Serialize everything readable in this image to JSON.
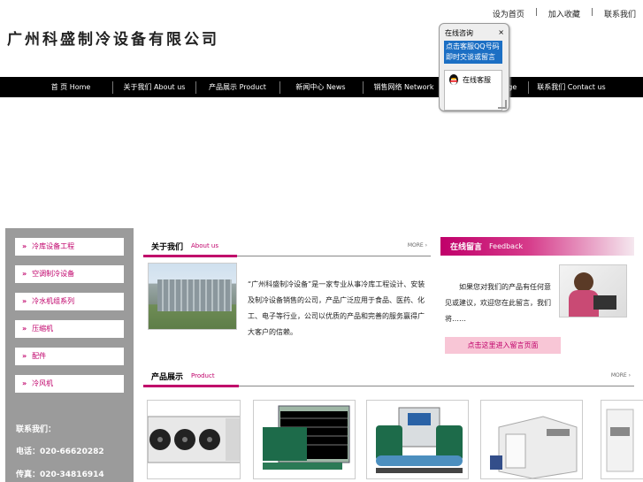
{
  "header": {
    "logo_text": "广州科盛制冷设备有限公司",
    "top_links": [
      "设为首页",
      "加入收藏",
      "联系我们"
    ],
    "top_sep": "|"
  },
  "nav": {
    "items": [
      {
        "label": "首  页 Home"
      },
      {
        "label": "关于我们 About us"
      },
      {
        "label": "产品展示 Product"
      },
      {
        "label": "新闻中心 News"
      },
      {
        "label": "销售网络 Network"
      },
      {
        "label": "在线留言 Message"
      },
      {
        "label": "联系我们 Contact us"
      }
    ]
  },
  "qq_float": {
    "title": "在线咨询",
    "close": "×",
    "message": "点击客服QQ号码即时交谈或留言",
    "contact_label": "在线客服"
  },
  "sidebar": {
    "items": [
      {
        "label": "冷库设备工程"
      },
      {
        "label": "空调制冷设备"
      },
      {
        "label": "冷水机组系列"
      },
      {
        "label": "压缩机"
      },
      {
        "label": "配件"
      },
      {
        "label": "冷风机"
      }
    ],
    "contact_title": "联系我们：",
    "phone1": "电话：020-66620282",
    "phone2": "传真：020-34816914"
  },
  "about": {
    "title_cn": "关于我们",
    "title_en": "About us",
    "more": "MORE ›",
    "text": "“广州科盛制冷设备”是一家专业从事冷库工程设计、安装及制冷设备销售的公司，产品广泛应用于食品、医药、化工、电子等行业，公司以优质的产品和完善的服务赢得广大客户的信赖。"
  },
  "feedback": {
    "title_cn": "在线留言",
    "title_en": "Feedback",
    "text": "如果您对我们的产品有任何意见或建议，欢迎您在此留言，我们将……",
    "button": "点击这里进入留言页面"
  },
  "products": {
    "title_cn": "产品展示",
    "title_en": "Product",
    "more": "MORE ›"
  },
  "colors": {
    "accent": "#c0006a",
    "nav_bg": "#000000",
    "sidebar_bg": "#9b9b9b",
    "feedback_btn_bg": "#f8c6d6"
  }
}
